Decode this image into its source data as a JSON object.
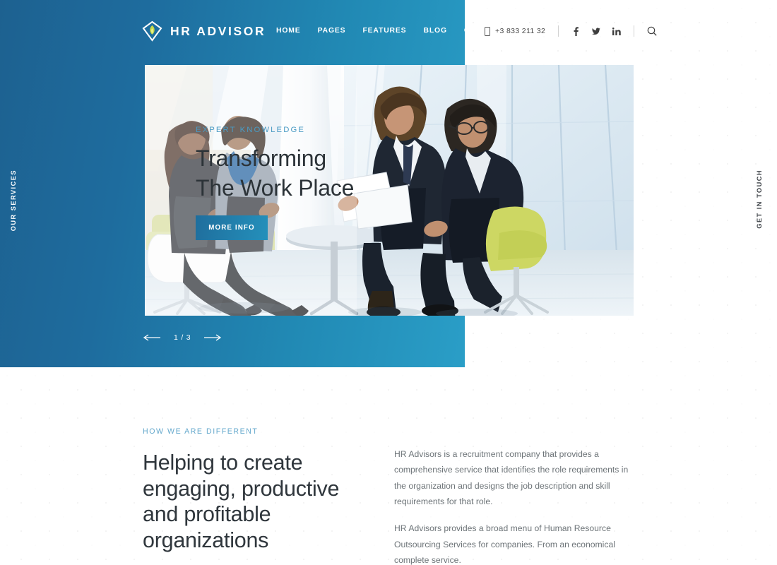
{
  "header": {
    "logo": {
      "text": "HR ADVISOR",
      "icon": "shield-flame-logo-icon"
    },
    "nav": [
      {
        "label": "HOME"
      },
      {
        "label": "PAGES"
      },
      {
        "label": "FEATURES"
      },
      {
        "label": "BLOG"
      },
      {
        "label": "CONTACTS"
      }
    ],
    "phone": {
      "icon": "phone-icon",
      "number": "+3 833 211 32"
    },
    "social": [
      {
        "name": "facebook-icon",
        "glyph": "f"
      },
      {
        "name": "twitter-icon",
        "glyph": "ᵗ"
      },
      {
        "name": "linkedin-icon",
        "glyph": "in"
      }
    ],
    "search": {
      "icon": "search-icon"
    }
  },
  "hero": {
    "eyebrow": "EXPERT KNOWLEDGE",
    "title": "Transforming\nThe Work Place",
    "button_label": "MORE INFO",
    "image_alt": "Four business people in suits seated in a bright modern glass office having a meeting around a small round table",
    "slider": {
      "prev_icon": "arrow-left-icon",
      "next_icon": "arrow-right-icon",
      "counter": "1 / 3"
    }
  },
  "side_tabs": {
    "left_label": "OUR SERVICES",
    "right_label": "GET IN TOUCH"
  },
  "difference": {
    "eyebrow": "HOW WE ARE DIFFERENT",
    "heading": "Helping to create engaging, productive and profitable organizations",
    "paragraphs": [
      "HR Advisors is a recruitment company that provides a comprehensive service that identifies the role requirements in the organization and designs the job description and skill requirements for that role.",
      "HR Advisors provides a broad menu of Human Resource Outsourcing Services for companies. From an economical complete service."
    ]
  },
  "colors": {
    "brand_dark_blue": "#1d6190",
    "brand_light_blue": "#2a9ec7",
    "accent_eyebrow": "#64a8cc",
    "heading_dark": "#2f363c",
    "body_text": "#6d7478",
    "logo_flame": "#c8d94a"
  }
}
